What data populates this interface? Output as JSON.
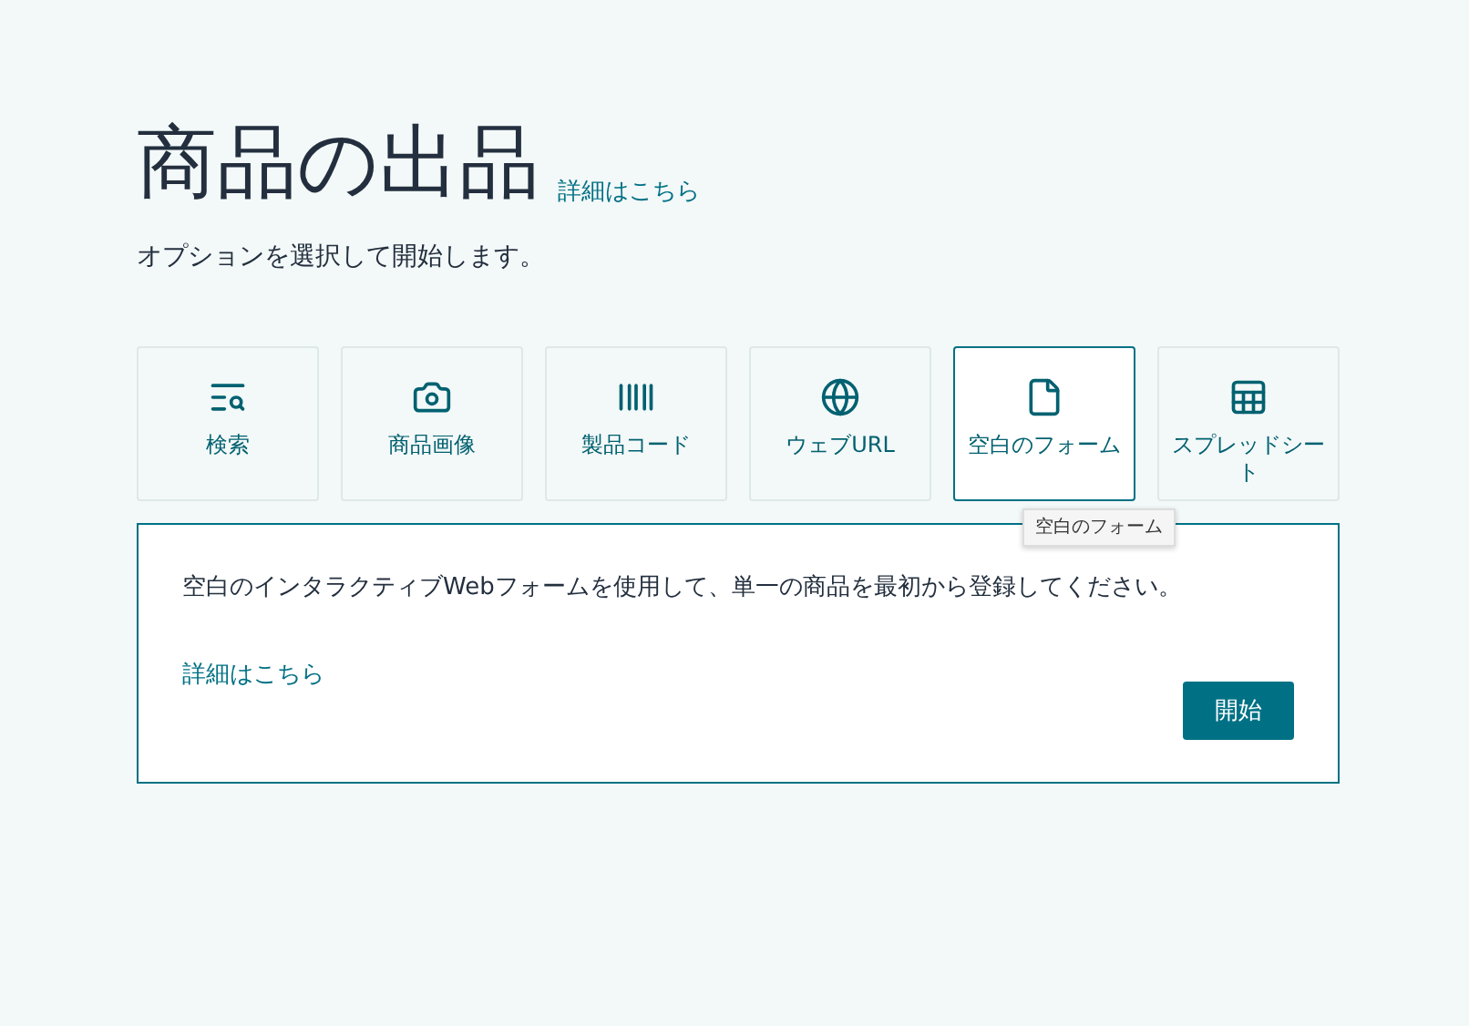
{
  "title": "商品の出品",
  "title_link": "詳細はこちら",
  "subtitle": "オプションを選択して開始します。",
  "options": [
    {
      "kind": "search",
      "label": "検索",
      "selected": false
    },
    {
      "kind": "camera",
      "label": "商品画像",
      "selected": false
    },
    {
      "kind": "barcode",
      "label": "製品コード",
      "selected": false
    },
    {
      "kind": "web",
      "label": "ウェブURL",
      "selected": false
    },
    {
      "kind": "form",
      "label": "空白のフォーム",
      "selected": true
    },
    {
      "kind": "sheet",
      "label": "スプレッドシート",
      "selected": false
    }
  ],
  "tooltip": "空白のフォーム",
  "panel": {
    "description": "空白のインタラクティブWebフォームを使用して、単一の商品を最初から登録してください。",
    "link": "詳細はこちら",
    "button": "開始"
  }
}
